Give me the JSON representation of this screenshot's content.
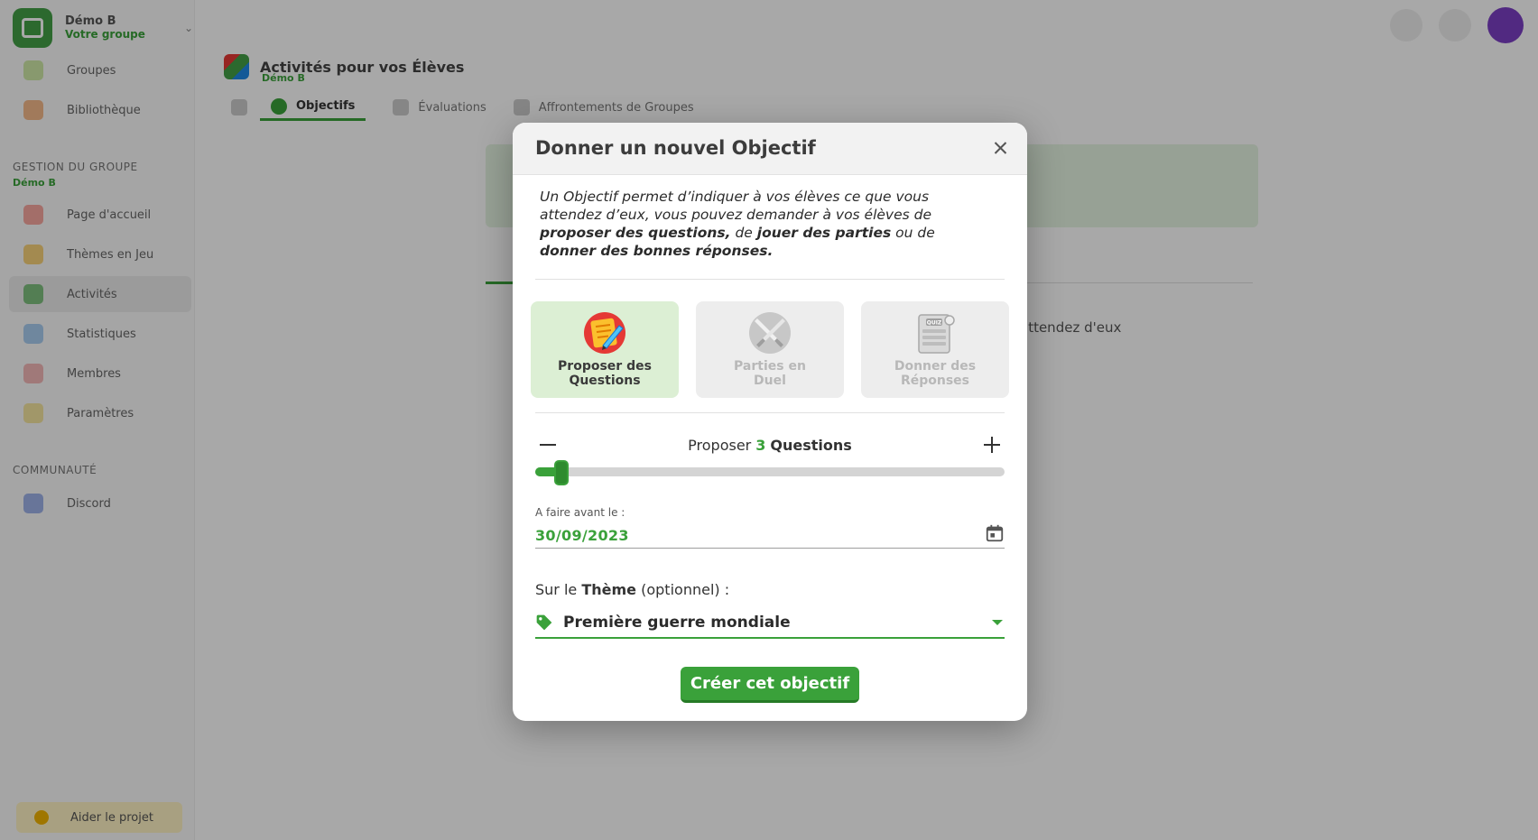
{
  "background": {
    "group": {
      "name": "Démo B",
      "subtitle": "Votre groupe"
    },
    "nav_top": [
      {
        "label": "Groupes",
        "color": "#cfe8a8"
      },
      {
        "label": "Bibliothèque",
        "color": "#f4b98a"
      }
    ],
    "section_title": "GESTION DU GROUPE",
    "section_subtitle": "Démo B",
    "nav_group": [
      {
        "label": "Page d'accueil",
        "color": "#f7a8a0"
      },
      {
        "label": "Thèmes en Jeu",
        "color": "#f7d27a"
      },
      {
        "label": "Activités",
        "color": "#7fbf7f"
      },
      {
        "label": "Statistiques",
        "color": "#a9cdf0"
      },
      {
        "label": "Membres",
        "color": "#f3b8b8"
      },
      {
        "label": "Paramètres",
        "color": "#f5e6a0"
      }
    ],
    "community_title": "COMMUNAUTÉ",
    "nav_community": [
      {
        "label": "Discord",
        "color": "#9fb2e8"
      }
    ],
    "donate_label": "Aider le projet",
    "page_title": "Activités pour vos Élèves",
    "page_subtitle": "Démo B",
    "tabs": [
      "Objectifs",
      "Évaluations",
      "Affrontements de Groupes"
    ],
    "panel_text": "attendez d'eux"
  },
  "modal": {
    "title": "Donner un nouvel Objectif",
    "close_icon": "close-icon",
    "intro": {
      "p1": "Un Objectif permet d’indiquer à vos élèves ce que vous attendez d’eux, vous pouvez demander à vos élèves de ",
      "b1": "proposer des questions,",
      "p2": " de ",
      "b2": "jouer des parties",
      "p3": " ou de ",
      "b3": "donner des bonnes réponses."
    },
    "choices": [
      {
        "label": "Proposer des Questions",
        "icon": "questions-icon",
        "selected": true
      },
      {
        "label": "Parties en Duel",
        "icon": "duel-swords-icon",
        "selected": false
      },
      {
        "label": "Donner des Réponses",
        "icon": "quiz-answers-icon",
        "selected": false
      }
    ],
    "count": {
      "prefix": "Proposer",
      "value": "3",
      "unit": "Questions",
      "slider_fraction": 0.055
    },
    "date": {
      "label": "A faire avant le :",
      "value": "30/09/2023"
    },
    "theme": {
      "label_prefix": "Sur le ",
      "label_bold": "Thème",
      "label_suffix": " (optionnel) :",
      "value": "Première guerre mondiale"
    },
    "submit_label": "Créer cet objectif",
    "accent_color": "#3aa13a"
  }
}
